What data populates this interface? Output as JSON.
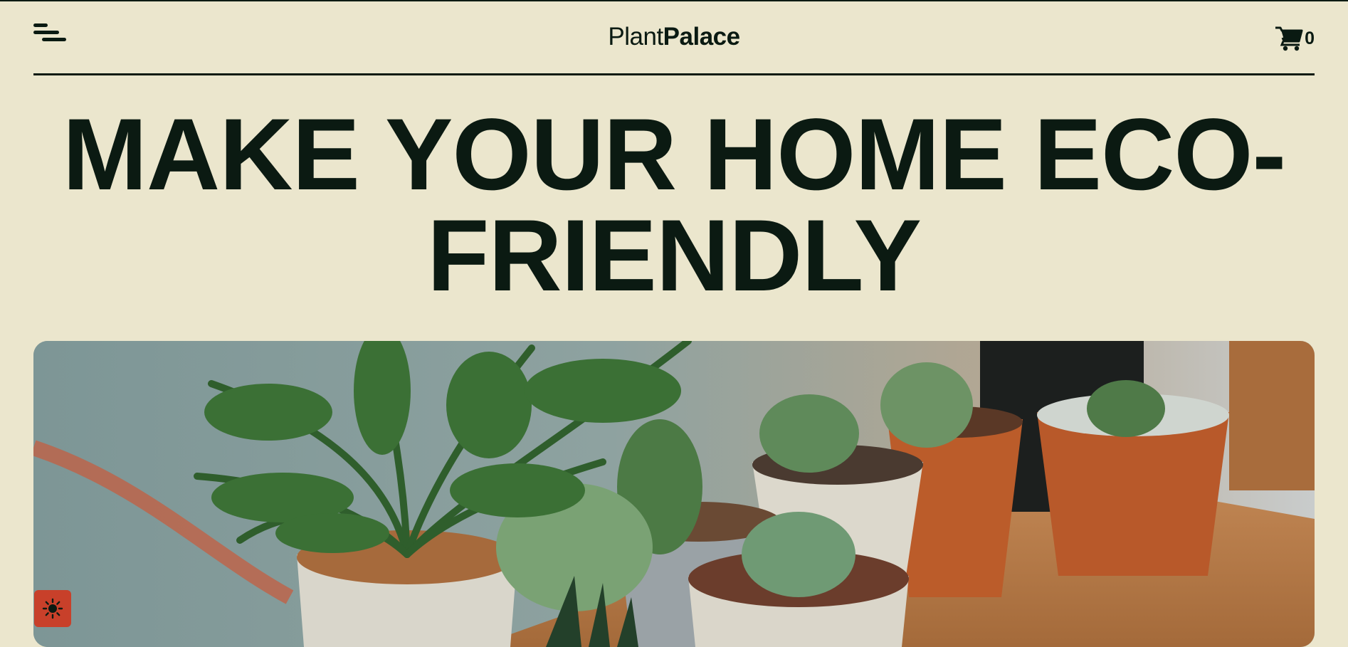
{
  "header": {
    "logo_light": "Plant",
    "logo_bold": "Palace",
    "cart_count": "0"
  },
  "hero": {
    "heading": "MAKE YOUR HOME ECO-FRIENDLY",
    "image_icon": "potted-plants-photo"
  },
  "icons": {
    "menu": "menu-icon",
    "cart": "shopping-cart-icon",
    "theme": "sun-icon"
  },
  "colors": {
    "background": "#ebe6cd",
    "ink": "#0a1a12",
    "accent": "#c8402a"
  }
}
